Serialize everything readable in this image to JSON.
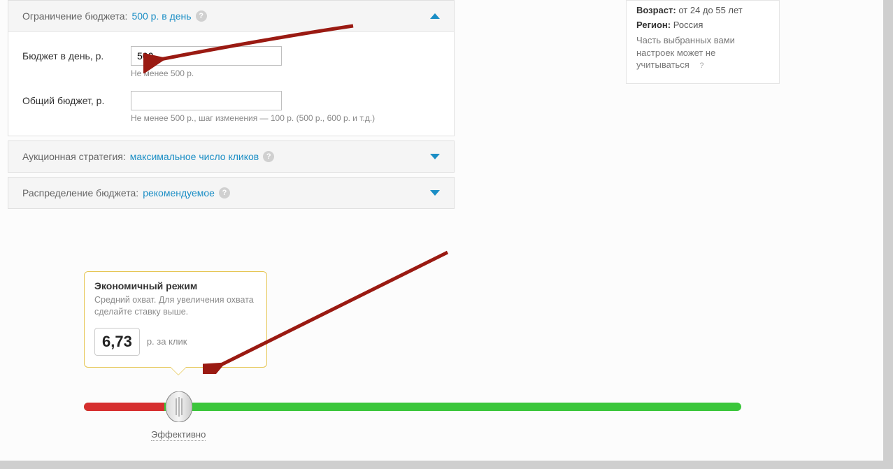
{
  "budgetLimit": {
    "label": "Ограничение бюджета:",
    "value": "500 р. в день",
    "dailyLabel": "Бюджет в день, р.",
    "dailyValue": "500",
    "dailyHint": "Не менее 500 р.",
    "totalLabel": "Общий бюджет, р.",
    "totalValue": "",
    "totalHint": "Не менее 500 р., шаг изменения — 100 р. (500 р., 600 р. и т.д.)"
  },
  "strategy": {
    "label": "Аукционная стратегия:",
    "value": "максимальное число кликов"
  },
  "distribution": {
    "label": "Распределение бюджета:",
    "value": "рекомендуемое"
  },
  "side": {
    "ageLabel": "Возраст:",
    "ageValue": "от 24 до 55 лет",
    "regionLabel": "Регион:",
    "regionValue": "Россия",
    "note": "Часть выбранных вами настроек может не учитываться"
  },
  "rate": {
    "title": "Экономичный режим",
    "desc": "Средний охват. Для увеличения охвата сделайте ставку выше.",
    "price": "6,73",
    "unit": "р. за клик",
    "effectiveLabel": "Эффективно"
  }
}
